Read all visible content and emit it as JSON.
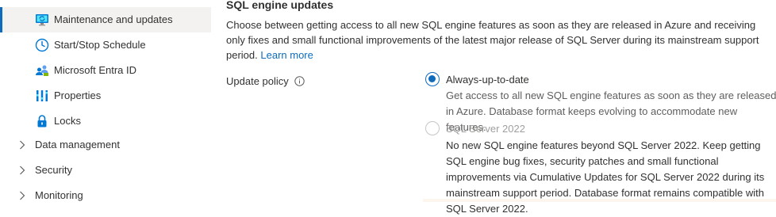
{
  "sidebar": {
    "items": [
      {
        "label": "Maintenance and updates",
        "icon": "maintenance-monitor-icon",
        "selected": true
      },
      {
        "label": "Start/Stop Schedule",
        "icon": "clock-icon"
      },
      {
        "label": "Microsoft Entra ID",
        "icon": "entra-id-icon"
      },
      {
        "label": "Properties",
        "icon": "properties-bars-icon"
      },
      {
        "label": "Locks",
        "icon": "lock-icon"
      }
    ],
    "groups": [
      {
        "label": "Data management",
        "icon": "chevron-right-icon"
      },
      {
        "label": "Security",
        "icon": "chevron-right-icon"
      },
      {
        "label": "Monitoring",
        "icon": "chevron-right-icon"
      }
    ]
  },
  "main": {
    "title": "SQL engine updates",
    "description": "Choose between getting access to all new SQL engine features as soon as they are released in Azure and receiving only fixes and small functional improvements of the latest major release of SQL Server during its mainstream support period.",
    "learn_more": "Learn more",
    "field_label": "Update policy",
    "options": [
      {
        "label": "Always-up-to-date",
        "description": "Get access to all new SQL engine features as soon as they are released in Azure. Database format keeps evolving to accommodate new features.",
        "selected": true
      },
      {
        "label": "SQL Server 2022",
        "description": "No new SQL engine features beyond SQL Server 2022. Keep getting SQL engine bug fixes, security patches and small functional improvements via Cumulative Updates for SQL Server 2022 during its mainstream support period. Database format remains compatible with SQL Server 2022.",
        "selected": false,
        "disabled": true
      }
    ]
  },
  "colors": {
    "accent": "#0f6cbd",
    "selected_bg": "#f3f2f1",
    "disabled_text": "#a19f9d"
  }
}
